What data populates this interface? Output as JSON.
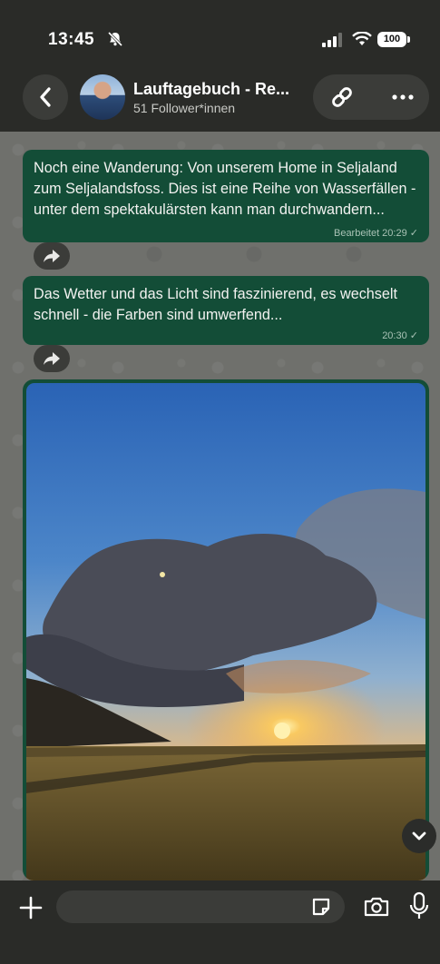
{
  "status_bar": {
    "time": "13:45",
    "battery": "100"
  },
  "header": {
    "title": "Lauftagebuch - Re...",
    "subtitle": "51 Follower*innen"
  },
  "messages": [
    {
      "text": "Noch eine Wanderung: Von unserem Home in Seljaland zum Seljalandsfoss. Dies ist eine Reihe von Wasserfällen - unter dem spektakulärsten kann man durchwandern...",
      "meta": "Bearbeitet 20:29 ✓"
    },
    {
      "text": "Das Wetter und das Licht sind faszinierend, es wechselt schnell - die Farben sind umwerfend...",
      "meta": "20:30 ✓"
    }
  ],
  "composer": {
    "placeholder": ""
  },
  "icons": [
    "back-icon",
    "link-icon",
    "more-icon",
    "forward-icon",
    "chevron-down-icon",
    "plus-icon",
    "sticker-icon",
    "camera-icon",
    "mic-icon",
    "bell-slash-icon",
    "signal-icon",
    "wifi-icon",
    "battery-icon"
  ],
  "colors": {
    "bubble": "#134d37",
    "chat_bg": "#6f706c",
    "bar": "#2a2b28"
  }
}
